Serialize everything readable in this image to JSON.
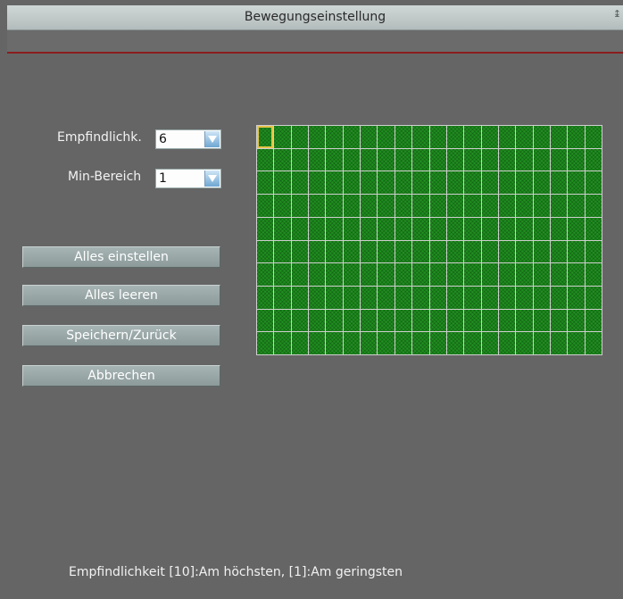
{
  "window": {
    "title": "Bewegungseinstellung"
  },
  "settings": {
    "sensitivity_label": "Empfindlichk.",
    "sensitivity_value": "6",
    "min_area_label": "Min-Bereich",
    "min_area_value": "1"
  },
  "buttons": {
    "set_all": "Alles einstellen",
    "clear_all": "Alles leeren",
    "save_back": "Speichern/Zurück",
    "cancel": "Abbrechen"
  },
  "grid": {
    "columns": 20,
    "rows": 10,
    "selected_cell": [
      0,
      0
    ]
  },
  "footer": {
    "hint": "Empfindlichkeit [10]:Am höchsten, [1]:Am geringsten"
  },
  "colors": {
    "active_cell": "#1f8f1f",
    "selected_outline": "#e6c34a",
    "accent_line": "#8a1d1d"
  },
  "icons": {
    "dropdown": "triangle-down-icon"
  }
}
